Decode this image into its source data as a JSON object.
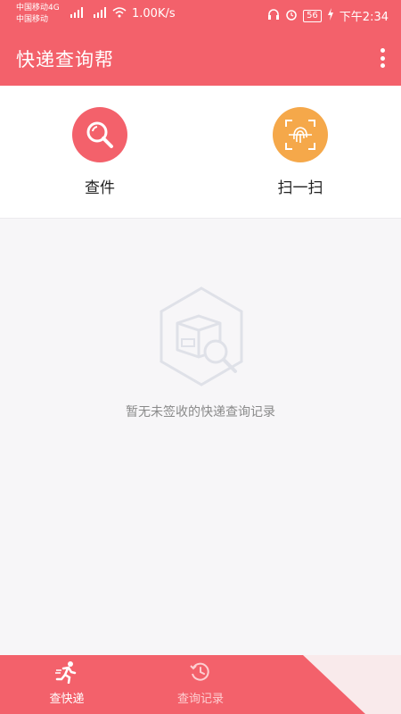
{
  "status_bar": {
    "carrier_line1": "中国移动4G",
    "carrier_line2": "中国移动",
    "speed": "1.00K/s",
    "battery": "56",
    "time": "下午2:34"
  },
  "app_bar": {
    "title": "快递查询帮"
  },
  "shortcuts": [
    {
      "label": "查件",
      "icon": "search-icon",
      "color": "#f3616b"
    },
    {
      "label": "扫一扫",
      "icon": "fingerprint-scan-icon",
      "color": "#f5a84a"
    }
  ],
  "empty_state": {
    "message": "暂无未签收的快递查询记录",
    "icon": "package-search-icon"
  },
  "bottom_nav": [
    {
      "label": "查快递",
      "icon": "runner-icon",
      "active": true
    },
    {
      "label": "查询记录",
      "icon": "history-clock-icon",
      "active": false
    }
  ],
  "colors": {
    "accent": "#f3616b",
    "scan": "#f5a84a",
    "background": "#f7f6f8"
  }
}
